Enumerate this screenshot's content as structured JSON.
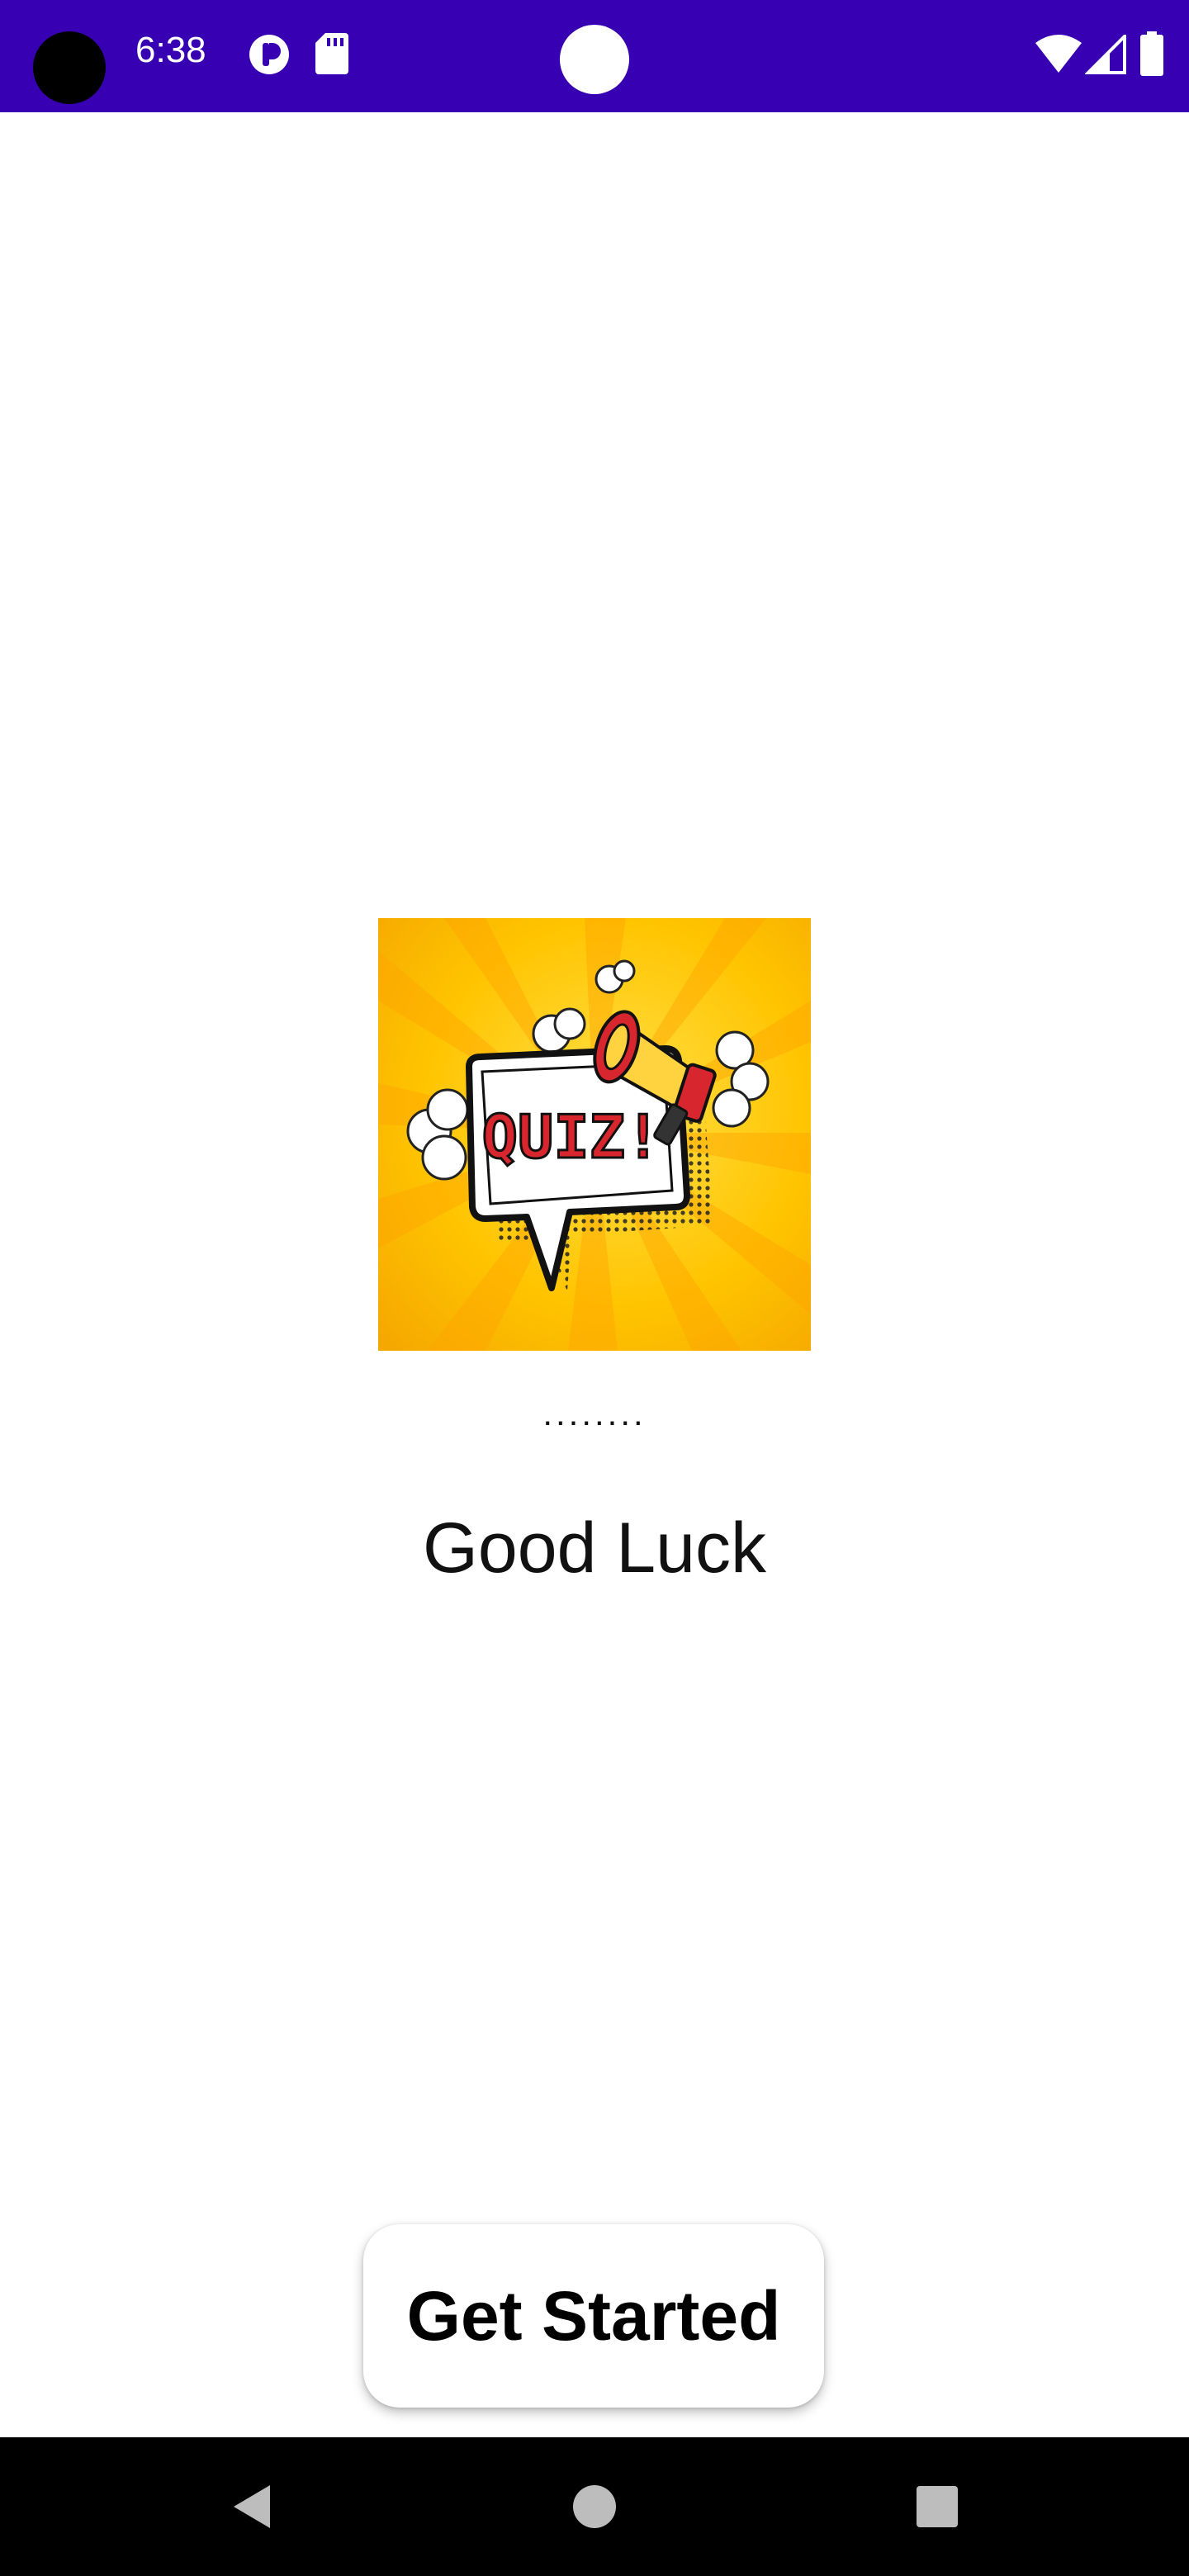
{
  "status_bar": {
    "time": "6:38",
    "icons": [
      "camera-cutout",
      "pocket-app-icon",
      "sd-card-icon",
      "wifi-icon",
      "cell-signal-icon",
      "battery-icon"
    ],
    "background": "#3700b3"
  },
  "splash": {
    "logo_text": "QUIZ!",
    "loading_dots": "........",
    "message": "Good Luck"
  },
  "actions": {
    "get_started_label": "Get Started"
  },
  "nav_bar": {
    "buttons": [
      "back",
      "home",
      "recents"
    ]
  }
}
